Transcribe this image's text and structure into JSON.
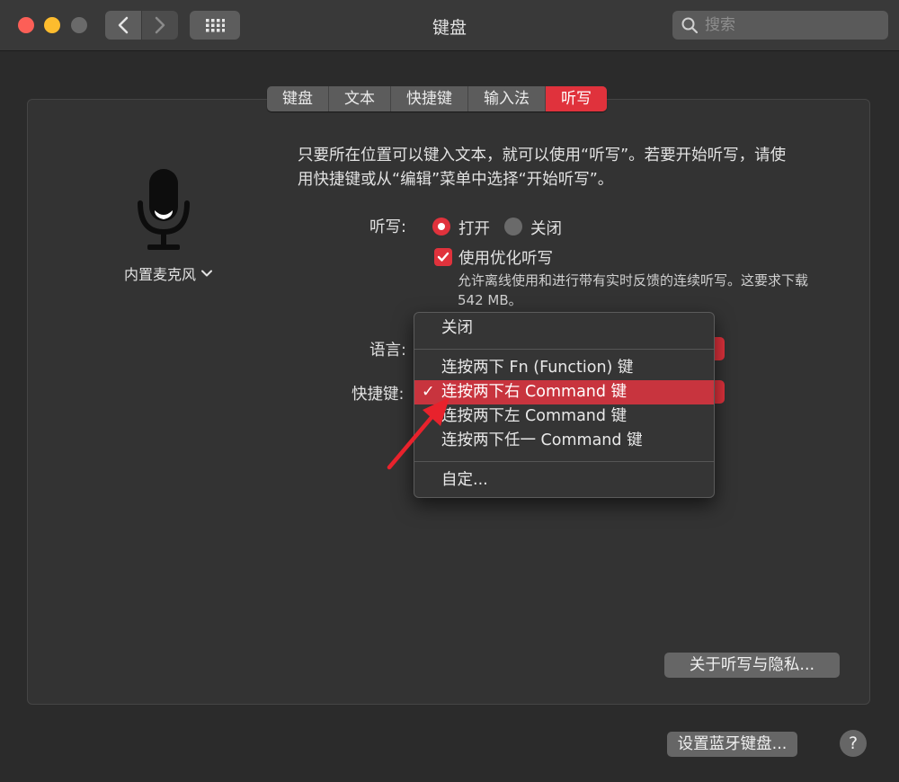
{
  "window": {
    "title": "键盘"
  },
  "search": {
    "placeholder": "搜索"
  },
  "tabs": [
    {
      "label": "键盘"
    },
    {
      "label": "文本"
    },
    {
      "label": "快捷键"
    },
    {
      "label": "输入法"
    },
    {
      "label": "听写",
      "active": true
    }
  ],
  "mic": {
    "label": "内置麦克风"
  },
  "dictation": {
    "description": "只要所在位置可以键入文本，就可以使用“听写”。若要开始听写，请使用快捷键或从“编辑”菜单中选择“开始听写”。",
    "label": "听写:",
    "on_label": "打开",
    "off_label": "关闭",
    "enhanced_label": "使用优化听写",
    "enhanced_desc": "允许离线使用和进行带有实时反馈的连续听写。这要求下载 542 MB。",
    "language_label": "语言:",
    "shortcut_label": "快捷键:"
  },
  "shortcut_menu": {
    "items": [
      {
        "label": "关闭"
      },
      {
        "label": "连按两下 Fn (Function) 键"
      },
      {
        "label": "连按两下右 Command 键",
        "selected": true
      },
      {
        "label": "连按两下左 Command 键"
      },
      {
        "label": "连按两下任一 Command 键"
      },
      {
        "label": "自定..."
      }
    ]
  },
  "buttons": {
    "about": "关于听写与隐私...",
    "bluetooth": "设置蓝牙键盘...",
    "help": "?"
  },
  "colors": {
    "accent": "#e0323c",
    "background": "#2b2b2b"
  }
}
